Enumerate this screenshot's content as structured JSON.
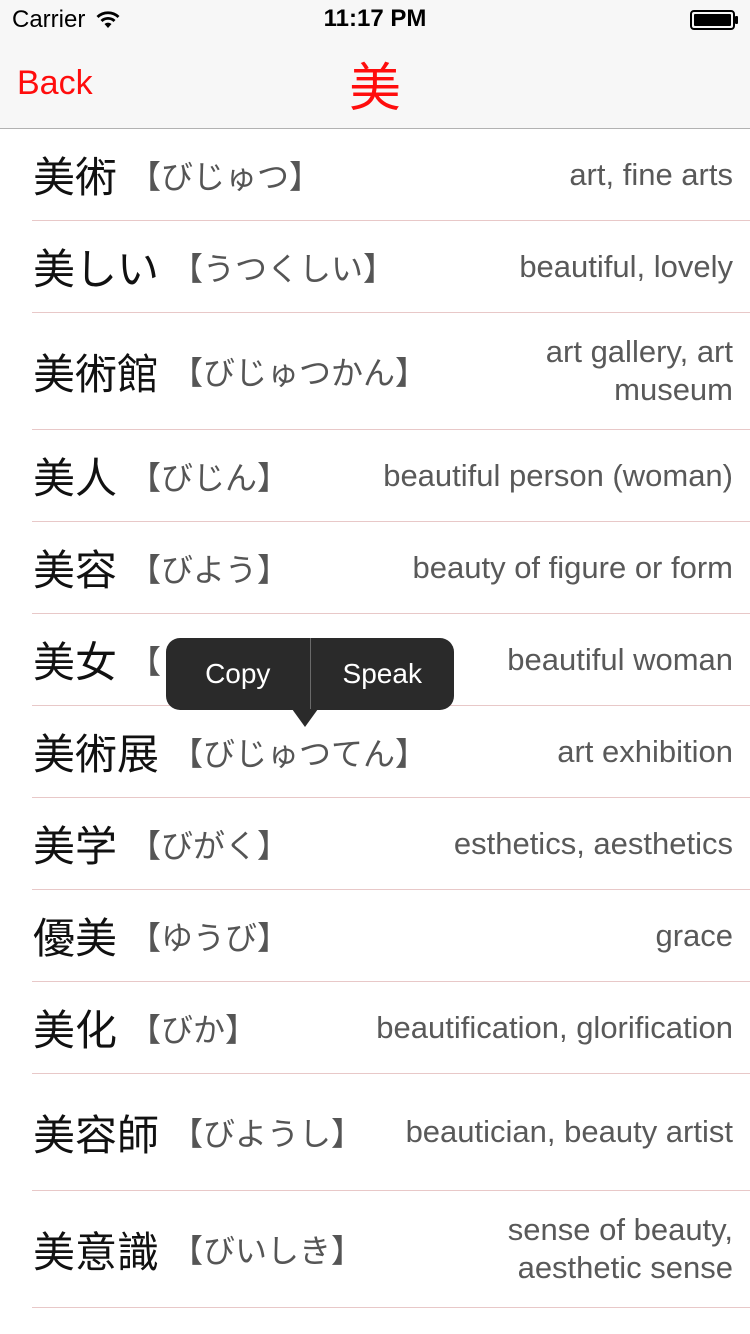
{
  "status_bar": {
    "carrier": "Carrier",
    "time": "11:17 PM",
    "wifi_icon": "wifi-icon",
    "battery_icon": "battery-icon"
  },
  "nav": {
    "back_label": "Back",
    "title": "美",
    "accent_color": "#ff0d0d"
  },
  "entries": [
    {
      "word": "美術",
      "reading": "【びじゅつ】",
      "meaning": "art, fine arts"
    },
    {
      "word": "美しい",
      "reading": "【うつくしい】",
      "meaning": "beautiful, lovely"
    },
    {
      "word": "美術館",
      "reading": "【びじゅつかん】",
      "meaning": "art gallery, art museum"
    },
    {
      "word": "美人",
      "reading": "【びじん】",
      "meaning": "beautiful person (woman)"
    },
    {
      "word": "美容",
      "reading": "【びよう】",
      "meaning": "beauty of figure or form"
    },
    {
      "word": "美女",
      "reading": "【",
      "meaning": "beautiful woman"
    },
    {
      "word": "美術展",
      "reading": "【びじゅつてん】",
      "meaning": "art exhibition"
    },
    {
      "word": "美学",
      "reading": "【びがく】",
      "meaning": "esthetics, aesthetics"
    },
    {
      "word": "優美",
      "reading": "【ゆうび】",
      "meaning": "grace"
    },
    {
      "word": "美化",
      "reading": "【びか】",
      "meaning": "beautification, glorification"
    },
    {
      "word": "美容師",
      "reading": "【びようし】",
      "meaning": "beautician, beauty artist"
    },
    {
      "word": "美意識",
      "reading": "【びいしき】",
      "meaning": "sense of beauty, aesthetic sense"
    }
  ],
  "popover": {
    "copy_label": "Copy",
    "speak_label": "Speak"
  }
}
